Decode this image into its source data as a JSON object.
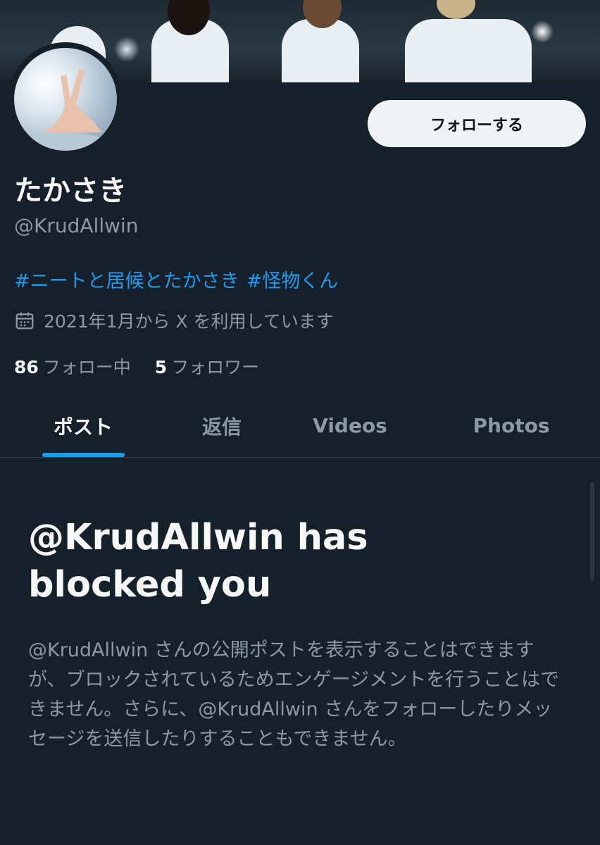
{
  "profile": {
    "display_name": "たかさき",
    "handle": "@KrudAllwin",
    "bio_hashtags": [
      "#ニートと居候とたかさき",
      "#怪物くん"
    ],
    "joined": "2021年1月から X を利用しています",
    "following_count": "86",
    "following_label": "フォロー中",
    "followers_count": "5",
    "followers_label": "フォロワー"
  },
  "actions": {
    "follow_label": "フォローする"
  },
  "tabs": [
    {
      "label": "ポスト",
      "active": true
    },
    {
      "label": "返信",
      "active": false
    },
    {
      "label": "Videos",
      "active": false
    },
    {
      "label": "Photos",
      "active": false
    }
  ],
  "blocked": {
    "title": "@KrudAllwin has blocked you",
    "body": "@KrudAllwin さんの公開ポストを表示することはできますが、ブロックされているためエンゲージメントを行うことはできません。さらに、@KrudAllwin さんをフォローしたりメッセージを送信したりすることもできません。"
  },
  "icons": {
    "calendar": "calendar-icon"
  },
  "colors": {
    "background": "#15202b",
    "accent": "#1d9bf0",
    "muted_text": "#8b98a5",
    "primary_text": "#f7f9f9",
    "button_bg": "#eff3f4"
  }
}
